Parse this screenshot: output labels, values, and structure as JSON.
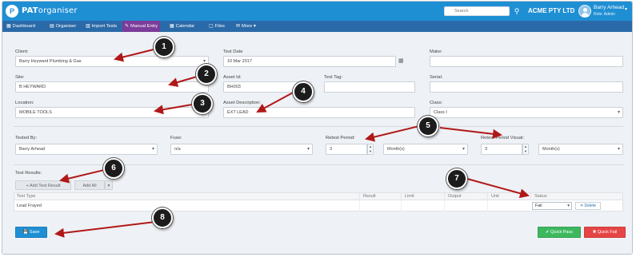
{
  "header": {
    "logo_letter": "P",
    "app_name_bold": "PAT",
    "app_name_rest": "organiser",
    "search": {
      "placeholder": "Search"
    },
    "search_icon": "search-icon",
    "company": "ACME PTY LTD",
    "user": {
      "name": "Barry Arhead",
      "role": "Role: Admin",
      "avatar_icon": "user-avatar-icon"
    }
  },
  "nav": {
    "items": [
      {
        "label": "Dashboard",
        "icon": "dashboard-icon",
        "glyph": "▦"
      },
      {
        "label": "Organiser",
        "icon": "organiser-icon",
        "glyph": "▤"
      },
      {
        "label": "Import Tests",
        "icon": "import-icon",
        "glyph": "▥"
      },
      {
        "label": "Manual Entry",
        "icon": "edit-icon",
        "glyph": "✎",
        "active": true
      },
      {
        "label": "Calendar",
        "icon": "calendar-icon",
        "glyph": "▦"
      },
      {
        "label": "Files",
        "icon": "files-icon",
        "glyph": "▢"
      },
      {
        "label": "More",
        "icon": "envelope-icon",
        "glyph": "✉",
        "caret": "▾"
      }
    ]
  },
  "form": {
    "client": {
      "label": "Client:",
      "value": "Barry Heyward Plumbing & Gas"
    },
    "test_date": {
      "label": "Test Date",
      "value": "10 Mar 2017"
    },
    "make": {
      "label": "Make:",
      "value": ""
    },
    "site": {
      "label": "Site:",
      "value": "B HEYWARD"
    },
    "asset_id": {
      "label": "Asset Id:",
      "value": "BH003"
    },
    "test_tag": {
      "label": "Test Tag:",
      "value": ""
    },
    "serial": {
      "label": "Serial:",
      "value": ""
    },
    "location": {
      "label": "Location:",
      "value": "MOBILE TOOLS"
    },
    "asset_description": {
      "label": "Asset Description:",
      "value": "EXT LEAD"
    },
    "class": {
      "label": "Class:",
      "value": "Class I"
    },
    "tested_by": {
      "label": "Tested By:",
      "value": "Barry Arhead"
    },
    "fuse": {
      "label": "Fuse:",
      "value": "n/a"
    },
    "retest_period": {
      "label": "Retest Period:",
      "value": "3",
      "unit": "Month(s)"
    },
    "retest_period_visual": {
      "label": "Retest Period Visual:",
      "value": "3",
      "unit": "Month(s)"
    }
  },
  "test_results": {
    "title": "Test Results:",
    "add_test_result": "+ Add Test Result",
    "add_all": "Add All",
    "add_all_caret": "▾",
    "columns": [
      "Test Type",
      "Result",
      "Limit",
      "Output",
      "Unit",
      "Status"
    ],
    "rows": [
      {
        "test_type": "Lead Frayed",
        "result": "",
        "limit": "",
        "output": "",
        "unit": "",
        "status": "Fail",
        "delete_label": "✕ Delete"
      }
    ]
  },
  "actions": {
    "save": "💾 Save",
    "quick_pass": "✔ Quick Pass",
    "quick_fail": "✖ Quick Fail"
  },
  "callouts": [
    "1",
    "2",
    "3",
    "4",
    "5",
    "6",
    "7",
    "8"
  ],
  "colors": {
    "header_blue": "#1f8fd4",
    "nav_blue": "#2b6aa8",
    "active_tab": "#7b3c9a",
    "pass_green": "#3db85f",
    "fail_red": "#e64545",
    "arrow_red": "#b01818"
  }
}
